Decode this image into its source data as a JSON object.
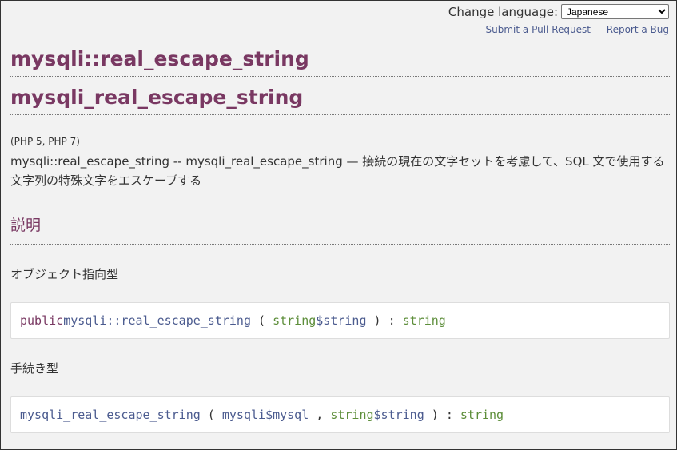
{
  "header": {
    "change_language_label": "Change language:",
    "language_selected": "Japanese",
    "submit_pr_link": "Submit a Pull Request",
    "report_bug_link": "Report a Bug"
  },
  "titles": {
    "oo_name": "mysqli::real_escape_string",
    "proc_name": "mysqli_real_escape_string"
  },
  "versions": "(PHP 5, PHP 7)",
  "purpose": "mysqli::real_escape_string -- mysqli_real_escape_string — 接続の現在の文字セットを考慮して、SQL 文で使用する文字列の特殊文字をエスケープする",
  "description": {
    "heading": "説明",
    "oo_style_label": "オブジェクト指向型",
    "proc_style_label": "手続き型",
    "oo_signature": {
      "modifier": "public",
      "method": "mysqli::real_escape_string",
      "open": " ( ",
      "param_type": "string",
      "param_name": "$string",
      "close": " ) : ",
      "return_type": "string"
    },
    "proc_signature": {
      "method": "mysqli_real_escape_string",
      "open": " ( ",
      "param1_type": "mysqli",
      "param1_name": "$mysql",
      "sep": " , ",
      "param2_type": "string",
      "param2_name": "$string",
      "close": " ) : ",
      "return_type": "string"
    }
  },
  "colors": {
    "title": "#793862",
    "link": "#4b5b8f",
    "type": "#5d8e3a",
    "background": "#f2f2f2"
  }
}
